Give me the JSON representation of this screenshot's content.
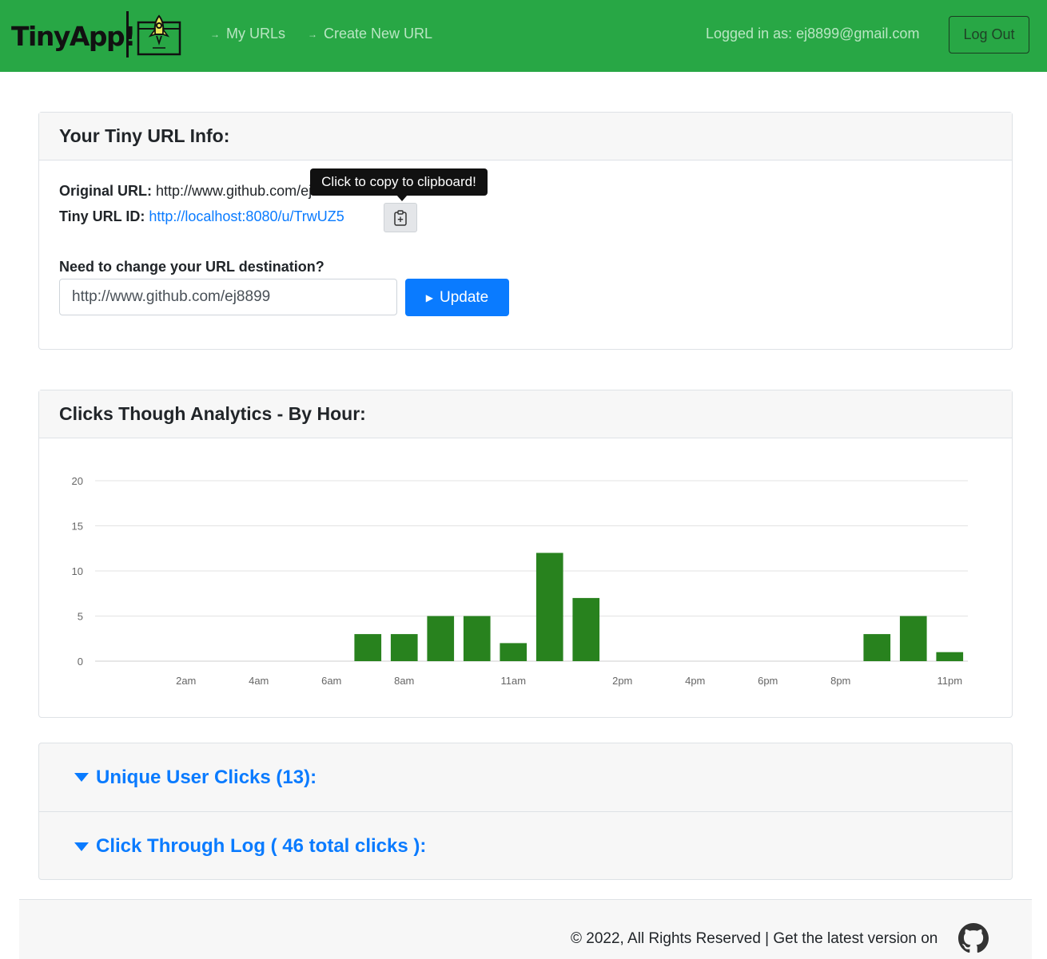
{
  "nav": {
    "brand": "TinyApp!",
    "my_urls": "My URLs",
    "create_new": "Create New URL",
    "logged_in": "Logged in as: ej8899@gmail.com",
    "logout": "Log Out"
  },
  "info": {
    "header": "Your Tiny URL Info:",
    "original_label": "Original URL:",
    "original_value": "http://www.github.com/ej8899",
    "tiny_label": "Tiny URL ID:",
    "tiny_value": "http://localhost:8080/u/TrwUZ5",
    "tooltip": "Click to copy to clipboard!",
    "change_label": "Need to change your URL destination?",
    "input_value": "http://www.github.com/ej8899",
    "update_label": "Update"
  },
  "chart_header": "Clicks Though Analytics - By Hour:",
  "chart_data": {
    "type": "bar",
    "title": "",
    "xlabel": "",
    "ylabel": "",
    "ylim": [
      0,
      20
    ],
    "y_ticks": [
      0,
      5,
      10,
      15,
      20
    ],
    "categories": [
      "12am",
      "1am",
      "2am",
      "3am",
      "4am",
      "5am",
      "6am",
      "7am",
      "8am",
      "9am",
      "10am",
      "11am",
      "12pm",
      "1pm",
      "2pm",
      "3pm",
      "4pm",
      "5pm",
      "6pm",
      "7pm",
      "8pm",
      "9pm",
      "10pm",
      "11pm"
    ],
    "values": [
      0,
      0,
      0,
      0,
      0,
      0,
      0,
      3,
      3,
      5,
      5,
      2,
      12,
      7,
      0,
      0,
      0,
      0,
      0,
      0,
      0,
      3,
      5,
      1
    ],
    "shown_tick_labels": [
      "2am",
      "4am",
      "6am",
      "8am",
      "11am",
      "2pm",
      "4pm",
      "6pm",
      "8pm",
      "11pm"
    ],
    "color": "#28821e",
    "grid": true
  },
  "accordion": {
    "unique_clicks": "Unique User Clicks (13):",
    "click_log": "Click Through Log ( 46 total clicks ):"
  },
  "footer": {
    "text": "© 2022, All Rights Reserved | Get the latest version on"
  }
}
